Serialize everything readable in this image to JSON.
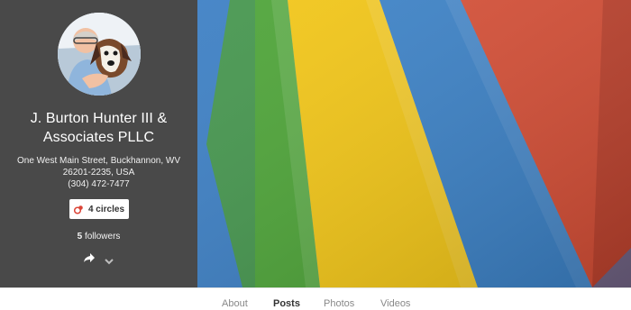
{
  "profile": {
    "business_name_line1": "J. Burton Hunter III &",
    "business_name_line2": "Associates PLLC",
    "address_line1": "One West Main Street, Buckhannon, WV",
    "address_line2": "26201-2235, USA",
    "phone": "(304) 472-7477",
    "circles_label": "4 circles",
    "followers_count": "5",
    "followers_label": "followers",
    "share_icon": "share-icon",
    "more_icon": "chevron-down-icon"
  },
  "tabs": [
    {
      "label": "About"
    },
    {
      "label": "Posts"
    },
    {
      "label": "Photos"
    },
    {
      "label": "Videos"
    }
  ],
  "colors": {
    "profile_panel": "#494949",
    "cover_blue": "#3f86cf",
    "cover_green": "#46a331",
    "cover_yellow": "#f3c614",
    "cover_red": "#d84f36",
    "accent_red": "#db4437"
  }
}
